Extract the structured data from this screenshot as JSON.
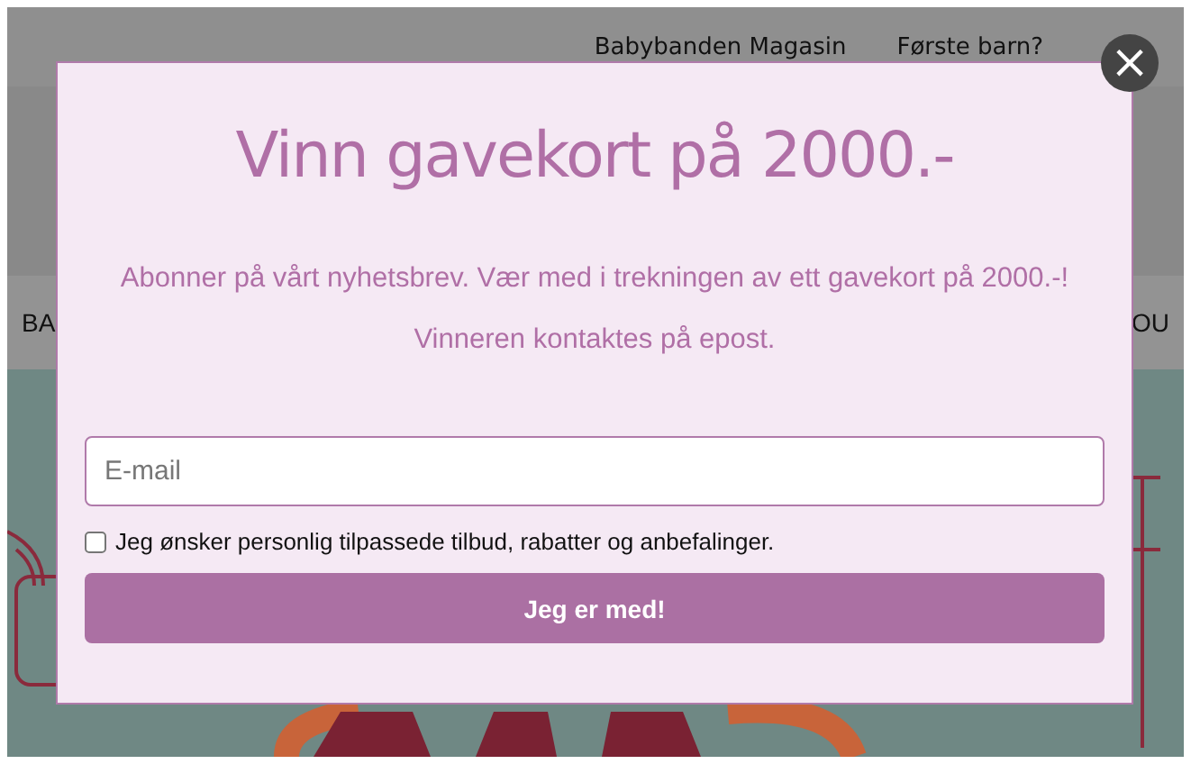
{
  "site": {
    "top_links": [
      "Babybanden Magasin",
      "Første barn?"
    ],
    "nav_fragments": [
      "BA",
      "OU"
    ]
  },
  "popup": {
    "title": "Vinn gavekort på 2000.-",
    "lines": [
      "Abonner på vårt nyhetsbrev. Vær med i trekningen av ett gavekort på 2000.-!",
      "Vinneren kontaktes på epost."
    ],
    "email": {
      "placeholder": "E-mail"
    },
    "consent": {
      "label": "Jeg ønsker personlig tilpassede tilbud, rabatter og anbefalinger.",
      "checked": false
    },
    "submit": "Jeg er med!",
    "close": "×"
  }
}
